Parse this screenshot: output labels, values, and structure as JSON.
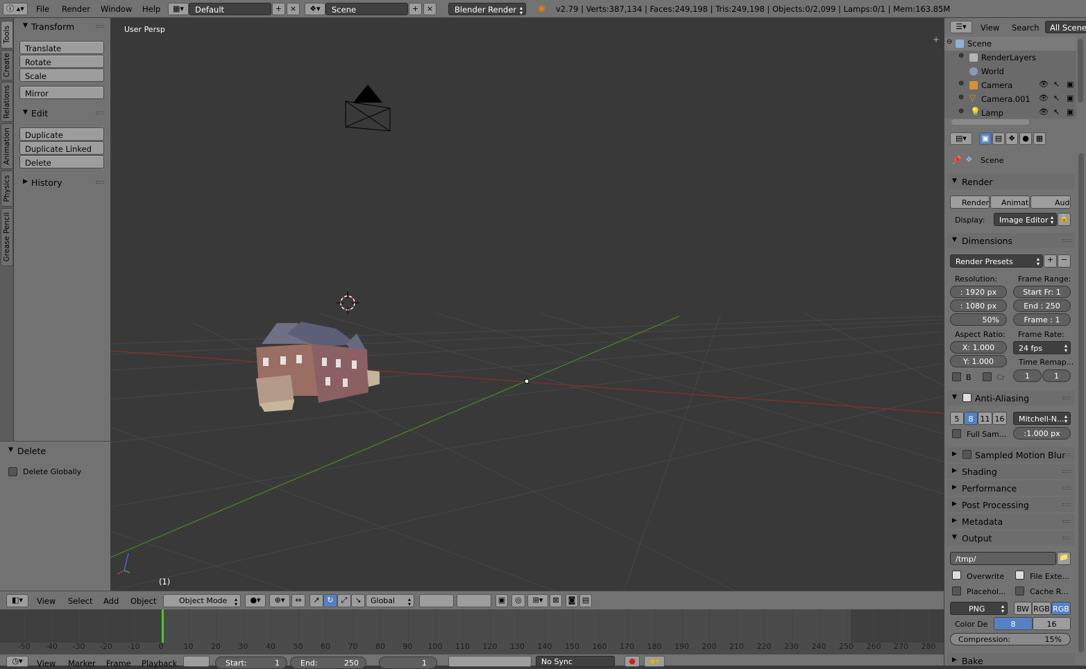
{
  "topbar": {
    "menus": [
      "File",
      "Render",
      "Window",
      "Help"
    ],
    "layout": "Default",
    "scene": "Scene",
    "engine": "Blender Render",
    "stats": "v2.79 | Verts:387,134 | Faces:249,198 | Tris:249,198 | Objects:0/2,099 | Lamps:0/1 | Mem:163.85M"
  },
  "tabs": [
    "Tools",
    "Create",
    "Relations",
    "Animation",
    "Physics",
    "Grease Pencil"
  ],
  "shelf": {
    "transform_title": "Transform",
    "transform": [
      "Translate",
      "Rotate",
      "Scale"
    ],
    "mirror": "Mirror",
    "edit_title": "Edit",
    "edit": [
      "Duplicate",
      "Duplicate Linked",
      "Delete"
    ],
    "history_title": "History"
  },
  "operator": {
    "title": "Delete",
    "option": "Delete Globally"
  },
  "viewport": {
    "label": "User Persp",
    "frame": "(1)"
  },
  "header3d": {
    "menus": [
      "View",
      "Select",
      "Add",
      "Object"
    ],
    "mode": "Object Mode",
    "orientation": "Global"
  },
  "timeline": {
    "ticks": [
      -50,
      -40,
      -30,
      -20,
      -10,
      0,
      10,
      20,
      30,
      40,
      50,
      60,
      70,
      80,
      90,
      100,
      110,
      120,
      130,
      140,
      150,
      160,
      170,
      180,
      190,
      200,
      210,
      220,
      230,
      240,
      250,
      260,
      270,
      280
    ],
    "current": 1,
    "menus": [
      "View",
      "Marker",
      "Frame",
      "Playback"
    ],
    "start_label": "Start:",
    "start": "1",
    "end_label": "End:",
    "end": "250",
    "current_field": "1",
    "sync": "No Sync"
  },
  "outliner": {
    "menus": [
      "View",
      "Search"
    ],
    "filter": "All Scenes",
    "rows": [
      "Scene",
      "RenderLayers",
      "World",
      "Camera",
      "Camera.001",
      "Lamp"
    ]
  },
  "props": {
    "context": "Scene",
    "render_title": "Render",
    "render_buttons": [
      "Render",
      "Animati",
      "Audio"
    ],
    "display_label": "Display:",
    "display": "Image Editor",
    "dimensions_title": "Dimensions",
    "presets": "Render Presets",
    "resolution_label": "Resolution:",
    "res_x": ": 1920 px",
    "res_y": ": 1080 px",
    "res_pct": "50%",
    "frame_range_label": "Frame Range:",
    "start_fr": "Start Fr: 1",
    "end_fr": "End : 250",
    "frame": "Frame : 1",
    "aspect_label": "Aspect Ratio:",
    "aspect_x": "X:  1.000",
    "aspect_y": "Y:  1.000",
    "frame_rate_label": "Frame Rate:",
    "fps": "24 fps",
    "border_b": "B",
    "border_cr": "Cr",
    "time_remap": "Time Remap...",
    "remap_old": "1",
    "remap_new": "1",
    "aa_title": "Anti-Aliasing",
    "aa_samples": [
      "5",
      "8",
      "11",
      "16"
    ],
    "aa_filter": "Mitchell-N...",
    "full_sample": "Full Sam...",
    "filter_size": ":1.000 px",
    "collapsed": [
      "Sampled Motion Blur",
      "Shading",
      "Performance",
      "Post Processing",
      "Metadata"
    ],
    "output_title": "Output",
    "output_path": "/tmp/",
    "overwrite": "Overwrite",
    "file_ext": "File Exte...",
    "placeholders": "Placehol...",
    "cache": "Cache R...",
    "format": "PNG",
    "color_modes": [
      "BW",
      "RGB",
      "RGB"
    ],
    "color_depth_label": "Color De",
    "depths": [
      "8",
      "16"
    ],
    "compression": "Compression:",
    "compression_val": "15%",
    "bake_title": "Bake"
  }
}
